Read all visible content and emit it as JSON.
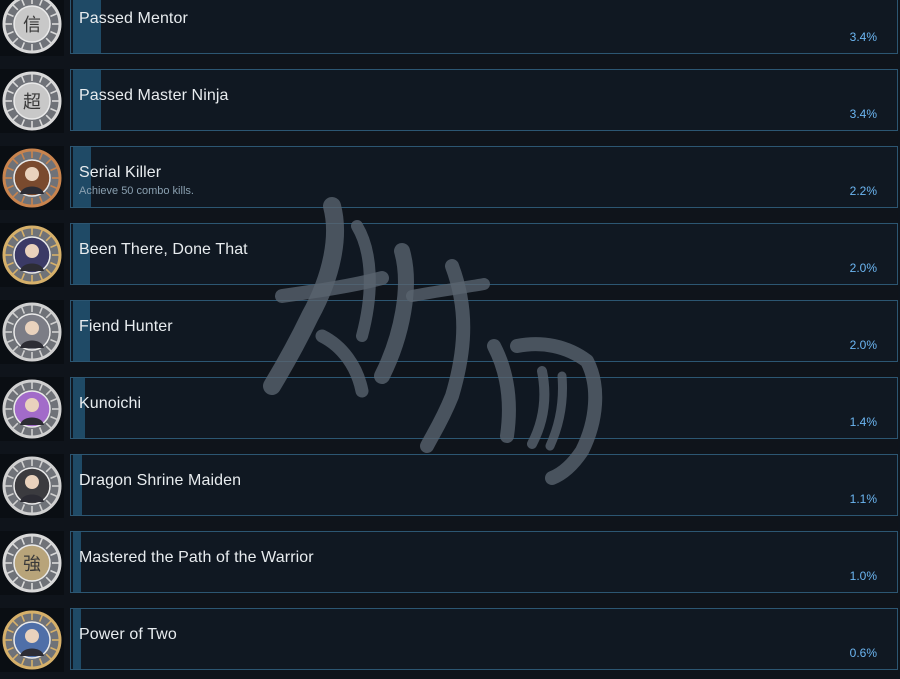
{
  "achievements": [
    {
      "name": "Passed Mentor",
      "description": "",
      "percent": "3.4%",
      "progress": 0.034,
      "icon": "silver-kanji-medal-icon",
      "glyph": "信",
      "center_color": "#c8c8c8",
      "ring_color": "#d9d9d9"
    },
    {
      "name": "Passed Master Ninja",
      "description": "",
      "percent": "3.4%",
      "progress": 0.034,
      "icon": "silver-kanji-medal-icon",
      "glyph": "超",
      "center_color": "#c8c8c8",
      "ring_color": "#d9d9d9"
    },
    {
      "name": "Serial Killer",
      "description": "Achieve 50 combo kills.",
      "percent": "2.2%",
      "progress": 0.022,
      "icon": "combo-kills-medal-icon",
      "glyph": "",
      "center_color": "#7a4a2e",
      "ring_color": "#c9844e"
    },
    {
      "name": "Been There, Done That",
      "description": "",
      "percent": "2.0%",
      "progress": 0.02,
      "icon": "ninja-group-medal-icon",
      "glyph": "",
      "center_color": "#3b3a66",
      "ring_color": "#d6b06a"
    },
    {
      "name": "Fiend Hunter",
      "description": "",
      "percent": "2.0%",
      "progress": 0.02,
      "icon": "blonde-warrior-medal-icon",
      "glyph": "",
      "center_color": "#7c7d86",
      "ring_color": "#d0d0d0"
    },
    {
      "name": "Kunoichi",
      "description": "",
      "percent": "1.4%",
      "progress": 0.014,
      "icon": "purple-hair-kunoichi-medal-icon",
      "glyph": "",
      "center_color": "#a26bc9",
      "ring_color": "#d0d0d0"
    },
    {
      "name": "Dragon Shrine Maiden",
      "description": "",
      "percent": "1.1%",
      "progress": 0.011,
      "icon": "shrine-maiden-medal-icon",
      "glyph": "",
      "center_color": "#3b3b3f",
      "ring_color": "#d0d0d0"
    },
    {
      "name": "Mastered the Path of the Warrior",
      "description": "",
      "percent": "1.0%",
      "progress": 0.01,
      "icon": "gold-kanji-medal-icon",
      "glyph": "強",
      "center_color": "#b8a47a",
      "ring_color": "#d9d9d9"
    },
    {
      "name": "Power of Two",
      "description": "",
      "percent": "0.6%",
      "progress": 0.006,
      "icon": "duo-fighters-medal-icon",
      "glyph": "",
      "center_color": "#4f6fa8",
      "ring_color": "#d6b06a"
    }
  ],
  "colors": {
    "background": "#0f141b",
    "card_bg": "#101822",
    "card_border": "#2c5672",
    "progress_fill": "#1f4a66",
    "percent_text": "#6cb6f2",
    "name_text": "#e8ecef",
    "watermark": "#5a6470"
  },
  "watermark": {
    "icon": "brush-calligraphy-watermark"
  }
}
